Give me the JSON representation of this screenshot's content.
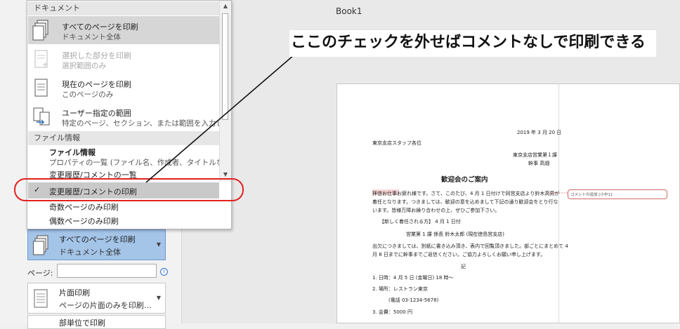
{
  "window": {
    "doc_title": "Book1"
  },
  "menu": {
    "section_document": "ドキュメント",
    "items": [
      {
        "title": "すべてのページを印刷",
        "sub": "ドキュメント全体"
      },
      {
        "title": "選択した部分を印刷",
        "sub": "選択範囲のみ"
      },
      {
        "title": "現在のページを印刷",
        "sub": "このページのみ"
      },
      {
        "title": "ユーザー指定の範囲",
        "sub": "特定のページ、セクション、または範囲を入力します"
      }
    ],
    "section_fileinfo": "ファイル情報",
    "fileinfo_title": "ファイル情報",
    "fileinfo_sub": "プロパティの一覧 (ファイル名、作成者、タイトルなど)",
    "revisions_list": "変更履歴/コメントの一覧",
    "print_markup": "変更履歴/コメントの印刷",
    "check_mark": "✓",
    "odd_pages": "奇数ページのみ印刷",
    "even_pages": "偶数ページのみ印刷"
  },
  "settings": {
    "scope_title": "すべてのページを印刷",
    "scope_sub": "ドキュメント全体",
    "pages_label": "ページ:",
    "pages_value": "",
    "info_icon": "i",
    "duplex_title": "片面印刷",
    "duplex_sub": "ページの片面のみを印刷…",
    "collate_title": "部単位で印刷"
  },
  "annotation": {
    "callout_text": "ここのチェックを外せばコメントなしで印刷できる",
    "accent_color": "#e22020"
  },
  "document": {
    "date": "2019 年 3 月 20 日",
    "to": "東京支店スタッフ各位",
    "from1": "東京支店営業第１課",
    "from2": "幹事  高畑",
    "heading": "歓迎会のご案内",
    "body1": "拝啓お仕事お疲れ様です。さて、このたび、4 月 1 日付けで同営支店より鈴木高男が",
    "body2": "着任となります。つきましては、歓迎の意を込めまして下記の通り歓迎会をとり行な",
    "body3": "います。皆様万障お繰り合わせの上、ぜひご参加下さい。",
    "new_staff": "【新しく着任される方】  4 月 1 日付",
    "staff_line": "営業第 1 課  係長      鈴木太郎  (現在徳島営支店)",
    "body4": "出欠につきましては、別紙に書き込み頂き、表内で回覧頂きました。部ごとにまとめて 4",
    "body5": "月 8 日までに幹事までご返信ください。ご協力よろしくお願い申し上げます。",
    "ki": "記",
    "item1": "1. 日時：4 月 5 日 (金曜日)   18 時〜",
    "item2": "2. 場所：レストラン東京",
    "tel": "(電話 03-1234-5678)",
    "item3": "3. 会費：5000 円",
    "comment": "コメントの追加 [小中1]: "
  }
}
